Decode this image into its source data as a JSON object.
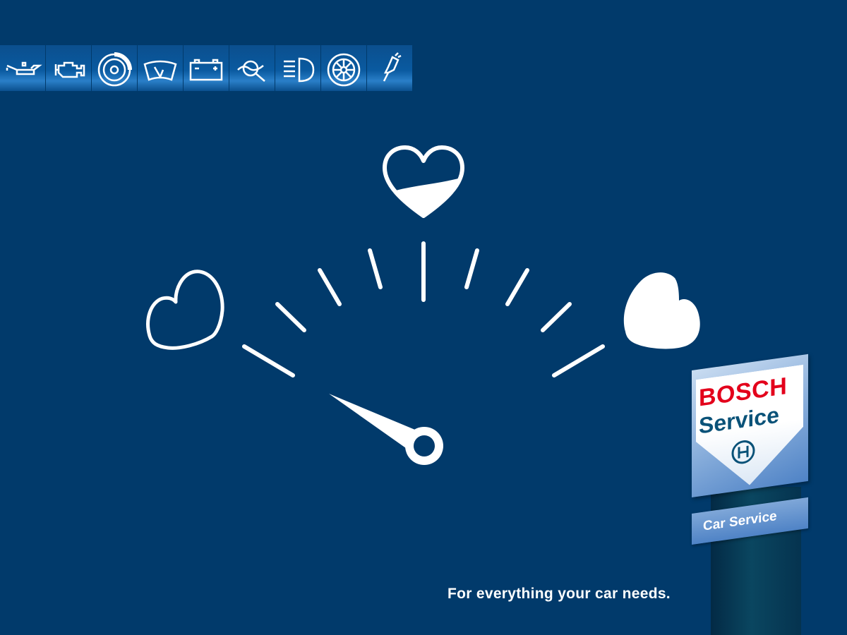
{
  "icon_bar": {
    "icons": [
      "oil-can-icon",
      "engine-icon",
      "brake-disc-icon",
      "windshield-wiper-icon",
      "battery-icon",
      "diagnostic-icon",
      "headlight-icon",
      "wheel-icon",
      "exhaust-icon"
    ]
  },
  "gauge": {
    "left_heart": "empty-heart-icon",
    "top_heart": "half-heart-icon",
    "right_heart": "full-heart-icon",
    "needle_level": 0.05
  },
  "tagline": "For everything your car needs.",
  "sign": {
    "brand": "BOSCH",
    "title": "Service",
    "subtitle": "Car Service",
    "brand_color": "#e3001b",
    "title_color": "#0a5278"
  },
  "colors": {
    "background": "#013a6b",
    "foreground": "#ffffff"
  }
}
